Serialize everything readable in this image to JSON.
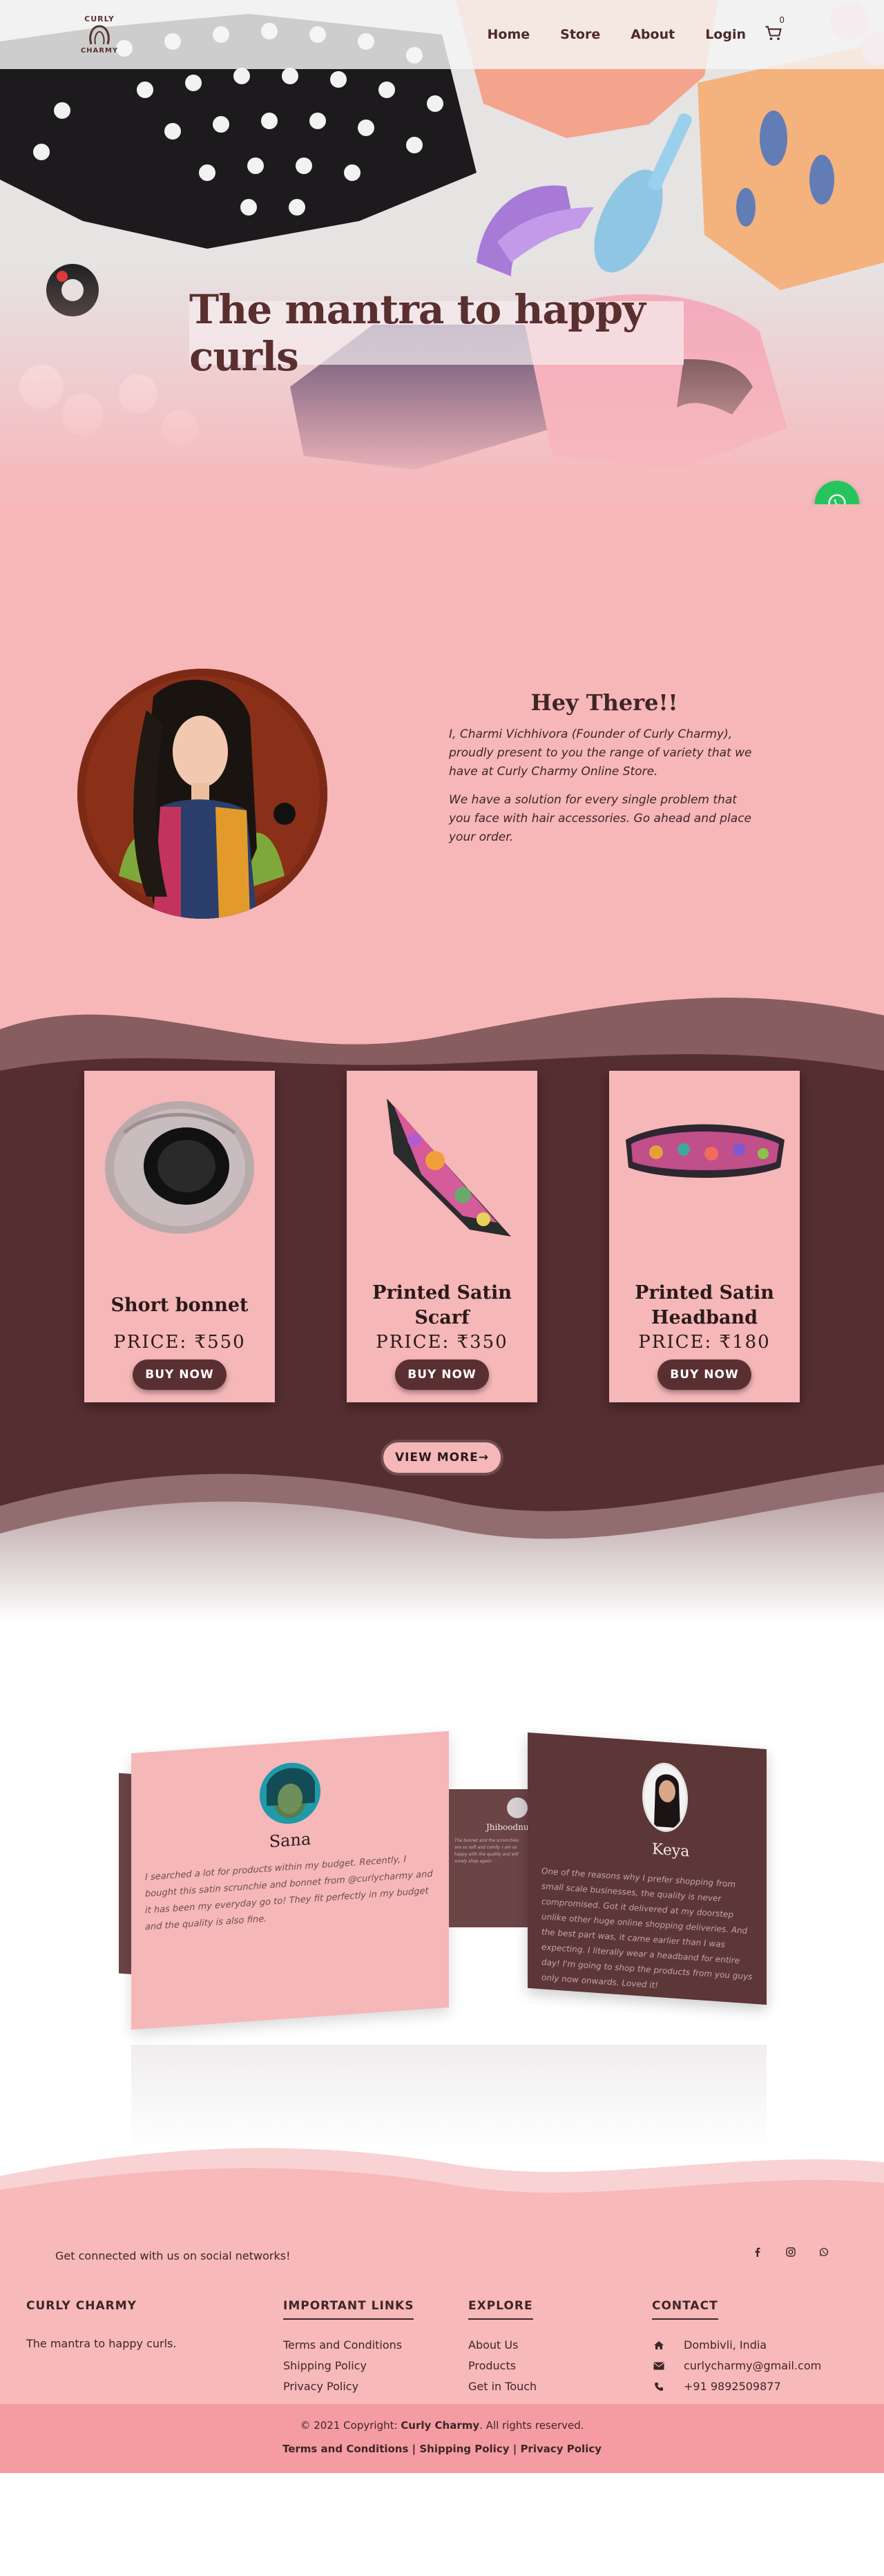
{
  "nav": {
    "logo_top": "CURLY",
    "logo_bottom": "CHARMY",
    "links": [
      "Home",
      "Store",
      "About",
      "Login"
    ],
    "cart_count": "0"
  },
  "hero": {
    "title": "The mantra to happy curls"
  },
  "about": {
    "heading": "Hey There!!",
    "paragraph_1": "I, Charmi Vichhivora (Founder of Curly Charmy), proudly present to you the range of variety that we have at Curly Charmy Online Store.",
    "paragraph_2": "We have a solution for every single problem that you face with hair accessories. Go ahead and place your order."
  },
  "products": {
    "items": [
      {
        "name": "Short bonnet",
        "price": "PRICE: ₹550",
        "button": "BUY NOW"
      },
      {
        "name": "Printed Satin Scarf",
        "price": "PRICE: ₹350",
        "button": "BUY NOW"
      },
      {
        "name": "Printed Satin Headband",
        "price": "PRICE: ₹180",
        "button": "BUY NOW"
      }
    ],
    "view_more": "VIEW MORE→"
  },
  "testimonials": {
    "items": [
      {
        "name": "Sana",
        "text": "I searched a lot for products within my budget. Recently, I bought this satin scrunchie and bonnet from @curlycharmy and it has been my everyday go to! They fit perfectly in my budget and the quality is also fine."
      },
      {
        "name": "Jhiboodnu",
        "text": "The bonnet and the scrunchies are so soft and comfy. I am so happy with the quality and will surely shop again."
      },
      {
        "name": "Keya",
        "text": "One of the reasons why I prefer shopping from small scale businesses, the quality is never compromised. Got it delivered at my doorstep unlike other huge online shopping deliveries. And the best part was, it came earlier than I was expecting. I literally wear a headband for entire day! I'm going to shop the products from you guys only now onwards. Loved it!"
      }
    ]
  },
  "footer": {
    "social_text": "Get connected with us on social networks!",
    "brand_heading": "CURLY CHARMY",
    "brand_tagline": "The mantra to happy curls.",
    "links_heading": "IMPORTANT LINKS",
    "links": [
      "Terms and Conditions",
      "Shipping Policy",
      "Privacy Policy"
    ],
    "explore_heading": "EXPLORE",
    "explore": [
      "About Us",
      "Products",
      "Get in Touch"
    ],
    "contact_heading": "CONTACT",
    "contact": {
      "location": "Dombivli, India",
      "email": "curlycharmy@gmail.com",
      "phone": "+91 9892509877"
    },
    "copyright_prefix": "© 2021 Copyright:",
    "copyright_brand": "Curly Charmy",
    "copyright_suffix": ". All rights reserved.",
    "bottom_links": [
      "Terms and Conditions",
      "Shipping Policy",
      "Privacy Policy"
    ],
    "separator": " | "
  },
  "colors": {
    "pink": "#f7b6b8",
    "maroon": "#552e31",
    "whatsapp": "#25c45c"
  }
}
